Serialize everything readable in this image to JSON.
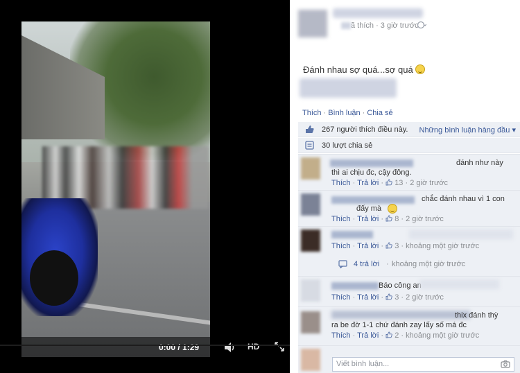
{
  "video": {
    "time": "0:00 / 1:29",
    "hd_label": "HD"
  },
  "post": {
    "header_meta": "ã thích · 3 giờ trước",
    "text": "Đánh nhau sợ quá...sợ quá",
    "actions": [
      "Thích",
      "Bình luận",
      "Chia sẻ"
    ]
  },
  "summary": {
    "likes": "267 người thích điều này.",
    "top_comments": "Những bình luận hàng đầu ▾",
    "shares": "30 lượt chia sẻ"
  },
  "comments": [
    {
      "line1": "đánh như này",
      "line2": "thì ai chịu đc, cậy đông.",
      "like": "Thích",
      "reply": "Trả lời",
      "count": "13",
      "time": "2 giờ trước"
    },
    {
      "line1": "chắc đánh nhau vì 1 con",
      "line2": "đấy mà",
      "like": "Thích",
      "reply": "Trả lời",
      "count": "8",
      "time": "2 giờ trước"
    },
    {
      "like": "Thích",
      "reply": "Trả lời",
      "count": "3",
      "time": "khoảng một giờ trước"
    },
    {
      "line1": "Báo công an",
      "like": "Thích",
      "reply": "Trả lời",
      "count": "3",
      "time": "2 giờ trước"
    },
    {
      "line1": "thix đánh thỳ",
      "line2": "ra be đờ 1-1 chứ đánh zay lấy số má đc",
      "like": "Thích",
      "reply": "Trả lời",
      "count": "2",
      "time": "khoảng một giờ trước"
    }
  ],
  "reply_thread": {
    "count_label": "4 trả lời",
    "time": "khoảng một giờ trước"
  },
  "composer": {
    "placeholder": "Viết bình luận..."
  },
  "colors": {
    "link": "#3b5998",
    "meta": "#8a8d91",
    "comment_bg": "#edf0f5"
  }
}
